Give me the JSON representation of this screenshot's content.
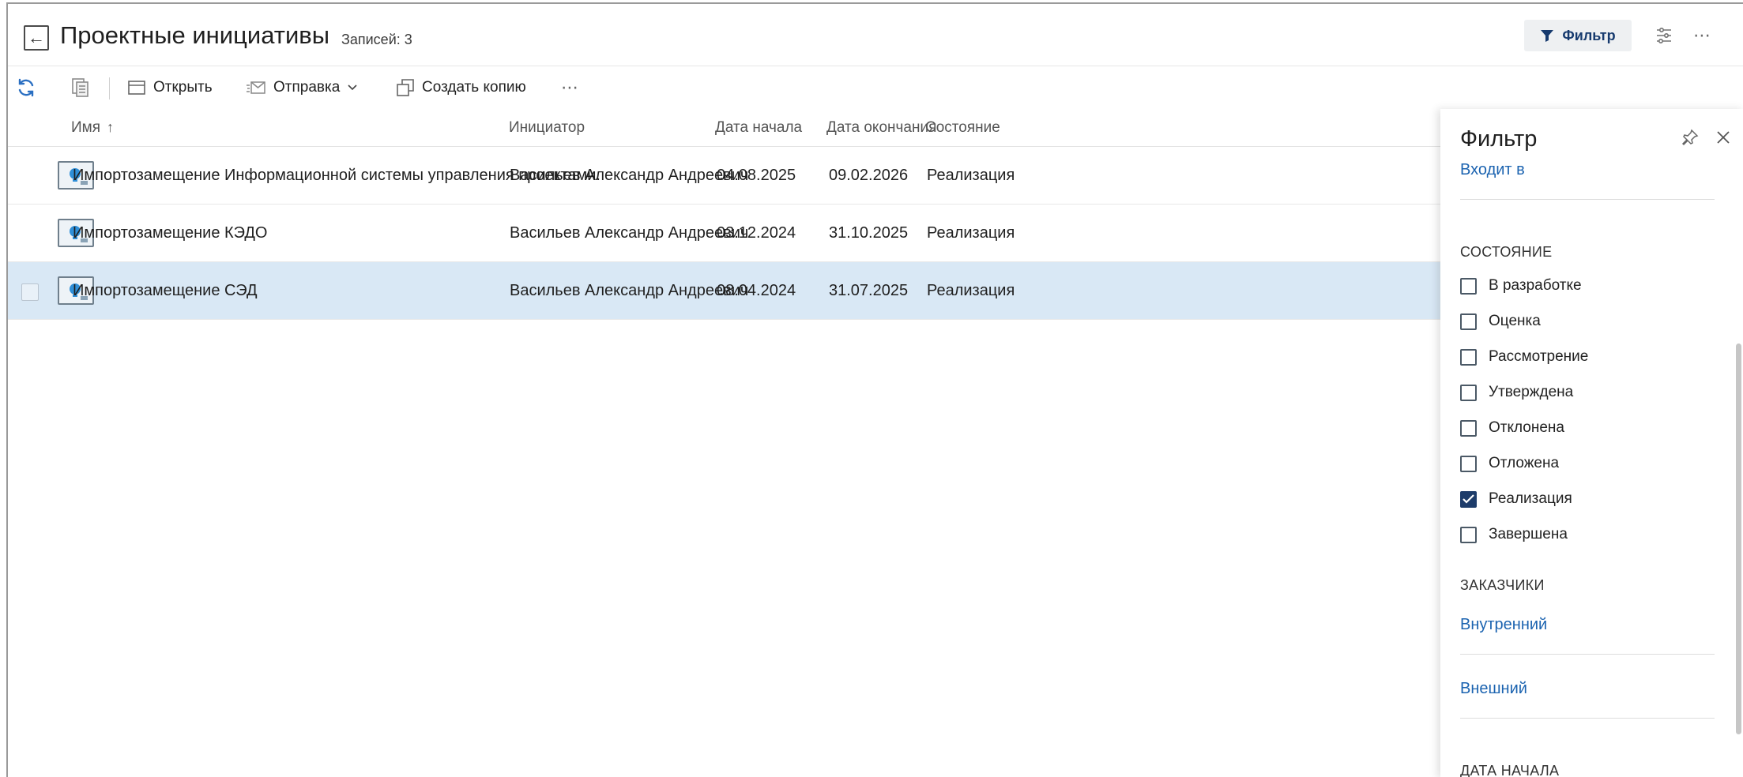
{
  "header": {
    "title": "Проектные инициативы",
    "records_count": "Записей: 3",
    "filter_button_label": "Фильтр"
  },
  "toolbar": {
    "open_label": "Открыть",
    "send_label": "Отправка",
    "copy_label": "Создать копию"
  },
  "table": {
    "columns": [
      "Имя",
      "Инициатор",
      "Дата начала",
      "Дата окончания",
      "Состояние"
    ],
    "sort_indicator": "↑",
    "rows": [
      {
        "name": "Импортозамещение Информационной системы управления проектами.",
        "initiator": "Васильев Александр Андреевич",
        "start": "04.08.2025",
        "end": "09.02.2026",
        "state": "Реализация",
        "selected": false
      },
      {
        "name": "Импортозамещение КЭДО",
        "initiator": "Васильев Александр Андреевич",
        "start": "03.12.2024",
        "end": "31.10.2025",
        "state": "Реализация",
        "selected": false
      },
      {
        "name": "Импортозамещение СЭД",
        "initiator": "Васильев Александр Андреевич",
        "start": "08.04.2024",
        "end": "31.07.2025",
        "state": "Реализация",
        "selected": true
      }
    ]
  },
  "filter_panel": {
    "title": "Фильтр",
    "top_link": "Входит в",
    "state_section": "СОСТОЯНИЕ",
    "states": [
      {
        "label": "В разработке",
        "checked": false
      },
      {
        "label": "Оценка",
        "checked": false
      },
      {
        "label": "Рассмотрение",
        "checked": false
      },
      {
        "label": "Утверждена",
        "checked": false
      },
      {
        "label": "Отклонена",
        "checked": false
      },
      {
        "label": "Отложена",
        "checked": false
      },
      {
        "label": "Реализация",
        "checked": true
      },
      {
        "label": "Завершена",
        "checked": false
      }
    ],
    "customers_section": "ЗАКАЗЧИКИ",
    "customers": [
      "Внутренний",
      "Внешний"
    ],
    "start_date_section": "ДАТА НАЧАЛА"
  },
  "colors": {
    "accent": "#1b63b0",
    "selected_row": "#d9e8f5",
    "checked_box": "#1d3c6a",
    "filter_button_text": "#163a6e"
  }
}
